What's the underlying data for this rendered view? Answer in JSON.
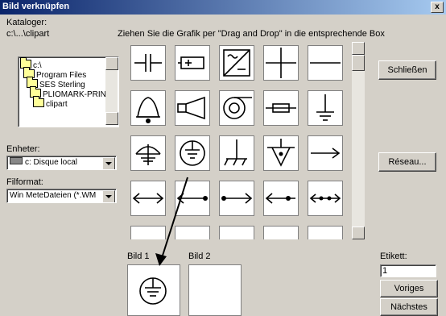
{
  "window": {
    "title": "Bild verknüpfen",
    "close_label": "x"
  },
  "left": {
    "catalog_label": "Kataloger:",
    "catalog_path": "c:\\...\\clipart",
    "tree": [
      "c:\\",
      "Program Files",
      "SES Sterling",
      "PLIOMARK-PRIN",
      "clipart"
    ],
    "units_label": "Enheter:",
    "units_value": "c: Disque local",
    "format_label": "Filformat:",
    "format_value": "Win MeteDateien (*.WM"
  },
  "instruction": "Ziehen Sie die Grafik per \"Drag and Drop\" in die entsprechende Box",
  "buttons": {
    "close": "Schließen",
    "network": "Réseau...",
    "prev": "Voriges",
    "next": "Nächstes"
  },
  "boxes": {
    "bild1": "Bild 1",
    "bild2": "Bild 2"
  },
  "label_field": {
    "label": "Etikett:",
    "value": "1"
  },
  "symbols": [
    [
      "capacitor-icon",
      "battery-icon",
      "dc-converter-icon",
      "cross-icon",
      "horizontal-line-icon"
    ],
    [
      "bell-icon",
      "horn-icon",
      "siren-icon",
      "fuse-icon",
      "ground-icon"
    ],
    [
      "antenna-ground-icon",
      "protective-earth-icon",
      "frame-ground-icon",
      "equipotential-icon",
      "arrow-right-icon"
    ],
    [
      "double-arrow-icon",
      "arrow-dot-right-icon",
      "dot-arrow-right-icon",
      "arrow-dot-left-icon",
      "double-arrow-dots-icon"
    ]
  ]
}
